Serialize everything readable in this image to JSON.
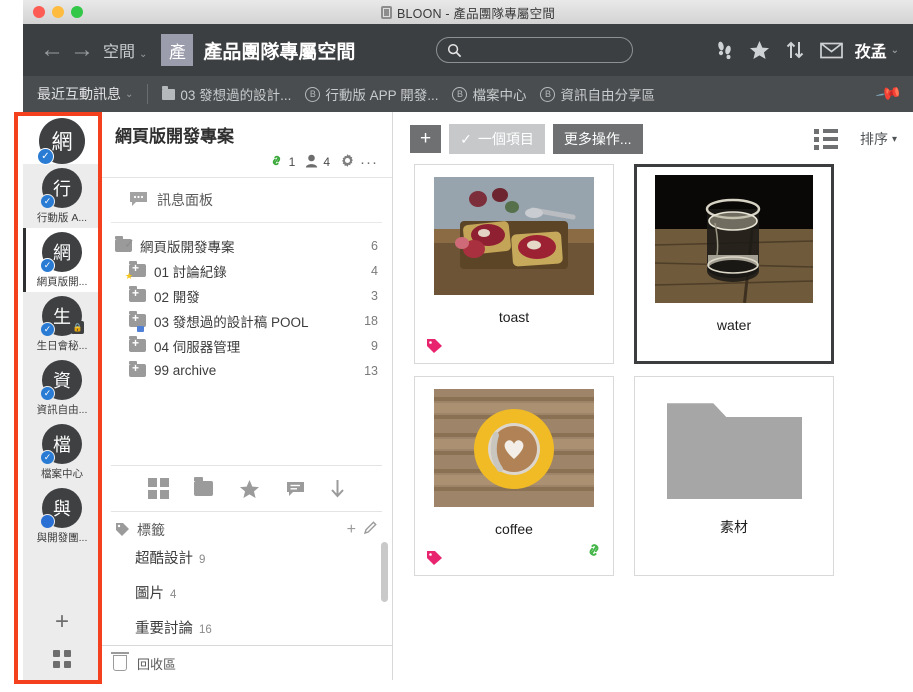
{
  "window": {
    "title": "BLOON - 產品團隊專屬空間",
    "app_icon": "app-icon",
    "traffic_lights": [
      "close",
      "minimize",
      "zoom"
    ]
  },
  "navbar": {
    "back_icon": "←",
    "forward_icon": "→",
    "space_menu_label": "空間",
    "caret": "⌄",
    "space_badge": "產",
    "space_title": "產品團隊專屬空間",
    "search": {
      "value": "",
      "placeholder": "",
      "icon": "search-icon"
    },
    "icons": [
      "footprints-icon",
      "star-icon",
      "sort-arrows-icon",
      "envelope-icon"
    ],
    "user_name": "孜孟"
  },
  "tabbar": {
    "recent_label": "最近互動訊息",
    "caret": "⌄",
    "tabs": [
      {
        "label": "03 發想過的設計...",
        "icon": "folder-icon"
      },
      {
        "label": "行動版 APP 開發...",
        "icon": "circle-b-icon"
      },
      {
        "label": "檔案中心",
        "icon": "circle-b-icon"
      },
      {
        "label": "資訊自由分享區",
        "icon": "circle-b-icon"
      }
    ],
    "pin_icon": "pin-icon"
  },
  "rail": {
    "header": {
      "avatar": "網",
      "badge": "check"
    },
    "items": [
      {
        "avatar": "行",
        "label": "行動版 A...",
        "badge": "check",
        "selected": false,
        "locked": false
      },
      {
        "avatar": "網",
        "label": "網頁版開...",
        "badge": "check",
        "selected": true,
        "locked": false
      },
      {
        "avatar": "生",
        "label": "生日會秘...",
        "badge": "check",
        "selected": false,
        "locked": true
      },
      {
        "avatar": "資",
        "label": "資訊自由...",
        "badge": "check",
        "selected": false,
        "locked": false
      },
      {
        "avatar": "檔",
        "label": "檔案中心",
        "badge": "check",
        "selected": false,
        "locked": false
      },
      {
        "avatar": "與",
        "label": "與開發團...",
        "badge": "dot",
        "selected": false,
        "locked": false
      }
    ],
    "add_label": "+",
    "grid_icon": "grid-icon"
  },
  "middle": {
    "title": "網頁版開發專案",
    "meta": {
      "link_icon": "link-icon",
      "link_count": "1",
      "people_icon": "person-icon",
      "people_count": "4",
      "gear_icon": "gear-icon",
      "more_icon": "···"
    },
    "message_panel": {
      "label": "訊息面板",
      "icon": "speech-bubble-icon"
    },
    "tree": [
      {
        "label": "網頁版開發專案",
        "count": "6",
        "level": 0,
        "icon": "folder-check-icon"
      },
      {
        "label": "01 討論紀錄",
        "count": "4",
        "level": 1,
        "icon": "folder-plus-icon",
        "star": true
      },
      {
        "label": "02 開發",
        "count": "3",
        "level": 1,
        "icon": "folder-plus-icon"
      },
      {
        "label": "03 發想過的設計稿 POOL",
        "count": "18",
        "level": 1,
        "icon": "folder-plus-icon",
        "blue": true
      },
      {
        "label": "04 伺服器管理",
        "count": "9",
        "level": 1,
        "icon": "folder-plus-icon"
      },
      {
        "label": "99 archive",
        "count": "13",
        "level": 1,
        "icon": "folder-plus-icon"
      }
    ],
    "viewbar_icons": [
      "grid-view-icon",
      "folder-view-icon",
      "star-view-icon",
      "comment-view-icon",
      "download-icon"
    ],
    "tags_header": {
      "label": "標籤",
      "icon": "tag-icon",
      "add_icon": "+",
      "edit_icon": "pencil-icon"
    },
    "tags": [
      {
        "label": "超酷設計",
        "count": "9"
      },
      {
        "label": "圖片",
        "count": "4"
      },
      {
        "label": "重要討論",
        "count": "16"
      }
    ],
    "trash": {
      "label": "回收區",
      "icon": "trash-icon"
    }
  },
  "content": {
    "toolbar": {
      "add_label": "+",
      "select_label": "一個項目",
      "select_icon": "check-icon",
      "more_label": "更多操作...",
      "listview_icon": "list-view-icon",
      "sort_label": "排序",
      "sort_caret": "▾"
    },
    "cards": [
      {
        "label": "toast",
        "type": "image",
        "selected": false,
        "has_tag": true,
        "has_link": false
      },
      {
        "label": "water",
        "type": "image",
        "selected": true,
        "has_tag": false,
        "has_link": false
      },
      {
        "label": "coffee",
        "type": "image",
        "selected": false,
        "has_tag": true,
        "has_link": true
      },
      {
        "label": "素材",
        "type": "folder",
        "selected": false,
        "has_tag": false,
        "has_link": false
      }
    ]
  },
  "colors": {
    "navbar": "#3c3f41",
    "tabbar": "#4a4d4f",
    "rail": "#ececec",
    "accent_blue": "#2a7bd4",
    "tag_pink": "#e8246f",
    "link_green": "#45b649",
    "annotation_red": "#f4401d"
  }
}
